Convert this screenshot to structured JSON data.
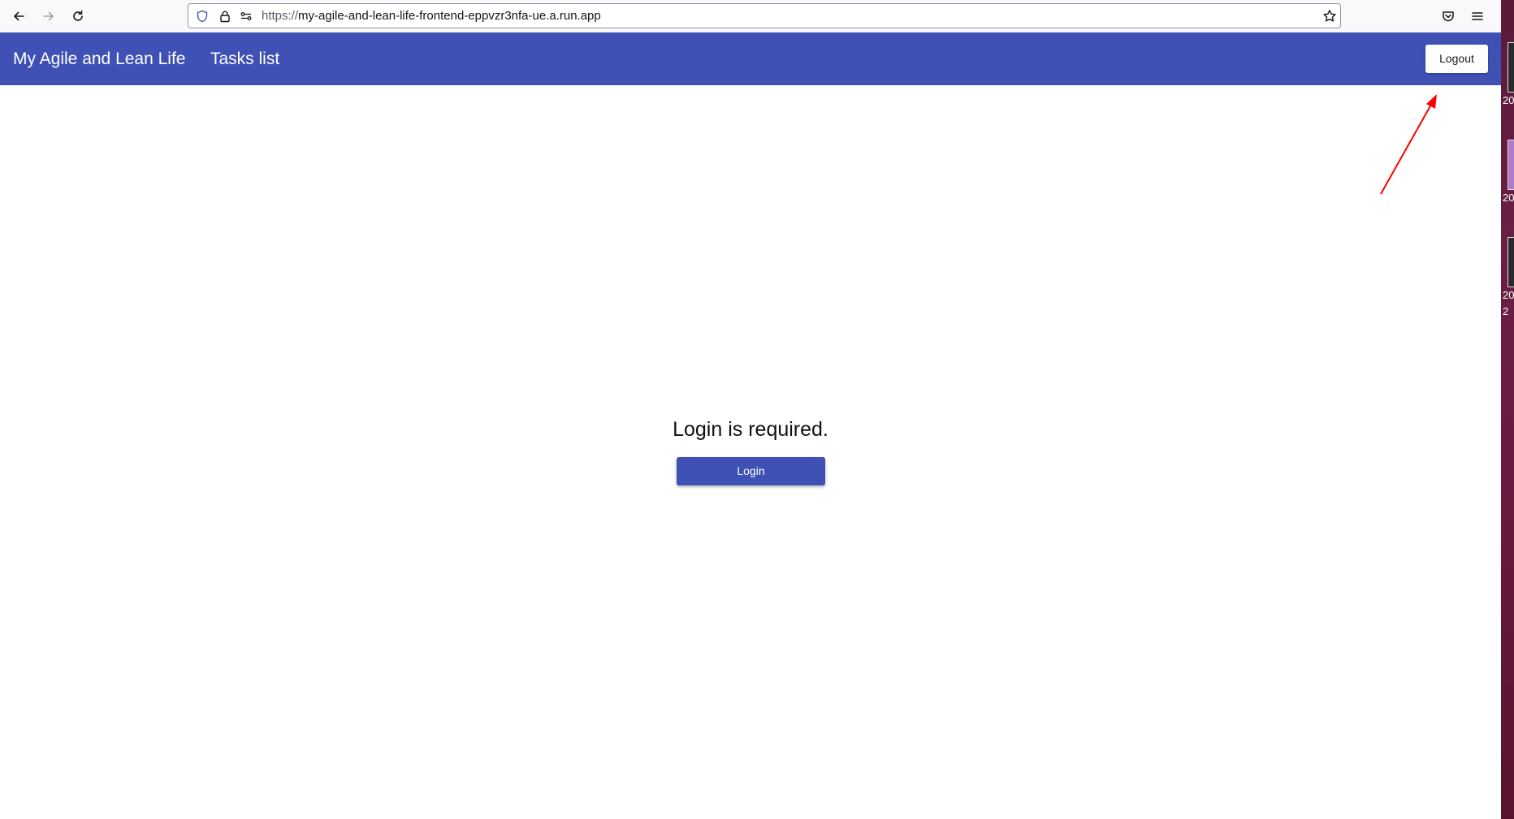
{
  "browser": {
    "url_scheme": "https://",
    "url_host": "my-agile-and-lean-life-frontend-eppvzr3nfa-ue.a.run.app",
    "icons": {
      "back": "back-arrow-icon",
      "forward": "forward-arrow-icon",
      "reload": "reload-icon",
      "tracking": "shield-icon",
      "security": "lock-icon",
      "permissions": "permissions-icon",
      "bookmark": "star-icon",
      "pocket": "pocket-icon",
      "menu": "hamburger-menu-icon"
    }
  },
  "app": {
    "brand": "My Agile and Lean Life",
    "nav": {
      "tasks_list": "Tasks list"
    },
    "logout_label": "Logout",
    "bar_color": "#3f51b5"
  },
  "content": {
    "message": "Login is required.",
    "login_label": "Login"
  },
  "annotation": {
    "arrow_color": "#ff0000",
    "points_to": "logout-button"
  },
  "desktop_strip": {
    "labels": [
      "20",
      "20",
      "20",
      "2"
    ]
  }
}
